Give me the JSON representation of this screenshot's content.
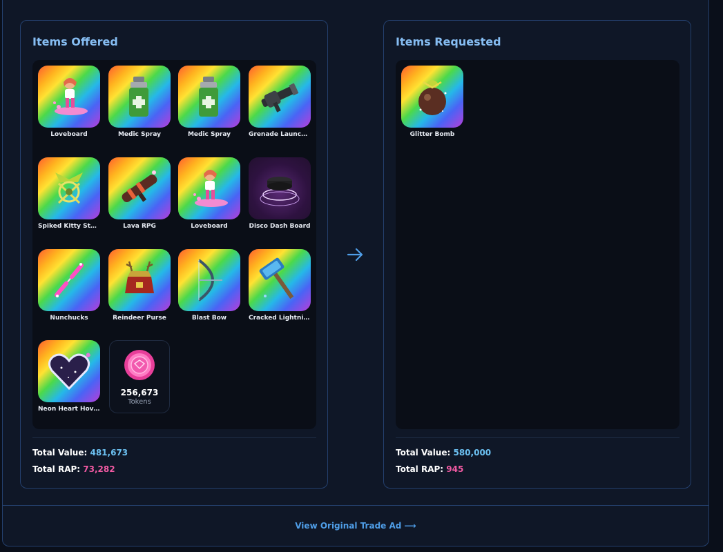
{
  "offered": {
    "title": "Items Offered",
    "items": [
      {
        "name": "Loveboard",
        "icon": "loveboard-icon"
      },
      {
        "name": "Medic Spray",
        "icon": "medic-spray-icon"
      },
      {
        "name": "Medic Spray",
        "icon": "medic-spray-icon"
      },
      {
        "name": "Grenade Launcher",
        "icon": "grenade-launcher-icon"
      },
      {
        "name": "Spiked Kitty Stanli",
        "icon": "spiked-kitty-icon"
      },
      {
        "name": "Lava RPG",
        "icon": "lava-rpg-icon"
      },
      {
        "name": "Loveboard",
        "icon": "loveboard-icon"
      },
      {
        "name": "Disco Dash Board",
        "icon": "disco-dash-board-icon"
      },
      {
        "name": "Nunchucks",
        "icon": "nunchucks-icon"
      },
      {
        "name": "Reindeer Purse",
        "icon": "reindeer-purse-icon"
      },
      {
        "name": "Blast Bow",
        "icon": "blast-bow-icon"
      },
      {
        "name": "Cracked Lightning ...",
        "icon": "cracked-lightning-icon"
      },
      {
        "name": "Neon Heart Hover...",
        "icon": "neon-heart-icon"
      }
    ],
    "tokens": {
      "amount": "256,673",
      "label": "Tokens"
    },
    "total_value_label": "Total Value:",
    "total_value": "481,673",
    "total_rap_label": "Total RAP:",
    "total_rap": "73,282"
  },
  "requested": {
    "title": "Items Requested",
    "items": [
      {
        "name": "Glitter Bomb",
        "icon": "glitter-bomb-icon"
      }
    ],
    "total_value_label": "Total Value:",
    "total_value": "580,000",
    "total_rap_label": "Total RAP:",
    "total_rap": "945"
  },
  "footer": {
    "link": "View Original Trade Ad ⟶"
  },
  "colors": {
    "accent_blue": "#6cc1f2",
    "accent_pink": "#f25aa3",
    "title_blue": "#86bdf2",
    "link_blue": "#4f9ee8"
  }
}
